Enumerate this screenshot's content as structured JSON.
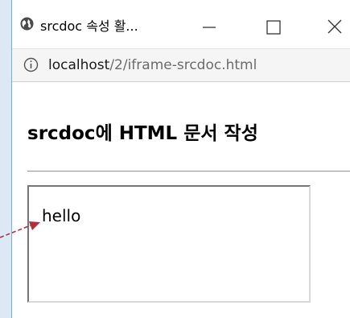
{
  "window": {
    "title": "srcdoc 속성 활...",
    "url_host": "localhost",
    "url_path": "/2/iframe-srcdoc.html"
  },
  "page": {
    "heading": "srcdoc에 HTML 문서 작성",
    "iframe_text": "hello"
  },
  "icons": {
    "tab": "globe-icon",
    "address": "info-icon",
    "minimize": "minimize-icon",
    "maximize": "maximize-icon",
    "close": "close-icon",
    "annotation": "arrow-pointer-icon"
  },
  "colors": {
    "annotation_arrow": "#b03040",
    "background": "#dce9f5"
  }
}
